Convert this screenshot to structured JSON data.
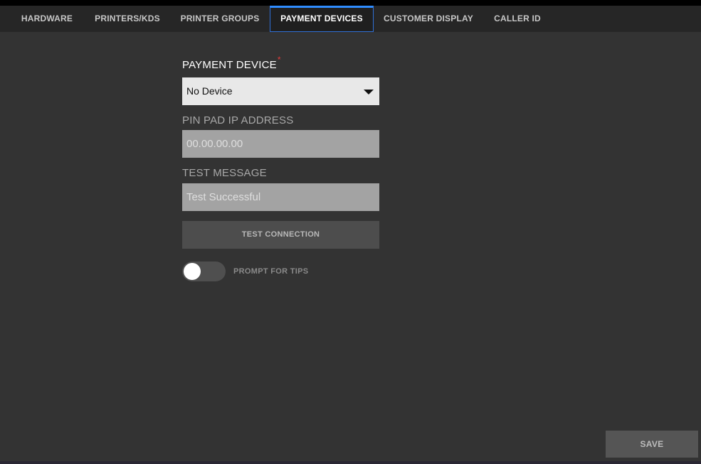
{
  "tabs": [
    {
      "label": "HARDWARE",
      "active": false
    },
    {
      "label": "PRINTERS/KDS",
      "active": false
    },
    {
      "label": "PRINTER GROUPS",
      "active": false
    },
    {
      "label": "PAYMENT DEVICES",
      "active": true
    },
    {
      "label": "CUSTOMER DISPLAY",
      "active": false
    },
    {
      "label": "CALLER ID",
      "active": false
    }
  ],
  "form": {
    "payment_device_label": "PAYMENT DEVICE",
    "required_mark": "*",
    "payment_device_value": "No Device",
    "pin_pad_label": "PIN PAD IP ADDRESS",
    "pin_pad_placeholder": "00.00.00.00",
    "test_message_label": "TEST MESSAGE",
    "test_message_placeholder": "Test Successful",
    "test_connection_label": "TEST CONNECTION",
    "prompt_for_tips_label": "PROMPT FOR TIPS",
    "prompt_for_tips_on": false
  },
  "footer": {
    "save_label": "SAVE"
  },
  "colors": {
    "background": "#333333",
    "tabbar": "#262626",
    "active_tab_accent": "#2f8cff",
    "required": "#e23b3b"
  }
}
